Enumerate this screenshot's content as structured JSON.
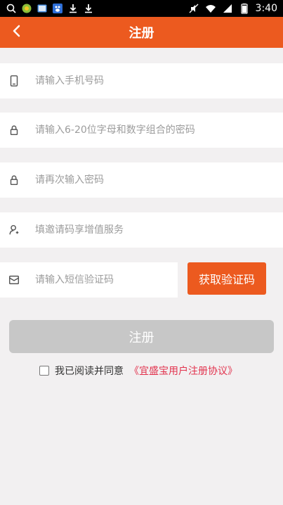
{
  "statusbar": {
    "left_icons": [
      "search-icon",
      "browser-icon",
      "photo-icon",
      "baidu-icon",
      "download-icon",
      "download-icon"
    ],
    "right_icons": [
      "mute-icon",
      "wifi-icon",
      "signal-icon",
      "battery-icon"
    ],
    "time": "3:40"
  },
  "topbar": {
    "title": "注册",
    "back_icon": "chevron-left-icon",
    "color": "#ec5a1f"
  },
  "form": {
    "phone": {
      "placeholder": "请输入手机号码",
      "icon": "phone-icon"
    },
    "password": {
      "placeholder": "请输入6-20位字母和数字组合的密码",
      "icon": "lock-icon"
    },
    "password_confirm": {
      "placeholder": "请再次输入密码",
      "icon": "lock-icon"
    },
    "invite": {
      "placeholder": "填邀请码享增值服务",
      "icon": "user-add-icon"
    },
    "sms": {
      "placeholder": "请输入短信验证码",
      "icon": "message-icon"
    },
    "get_code_label": "获取验证码"
  },
  "register_label": "注册",
  "agreement": {
    "text": "我已阅读并同意",
    "link": "《宜盛宝用户注册协议》"
  }
}
